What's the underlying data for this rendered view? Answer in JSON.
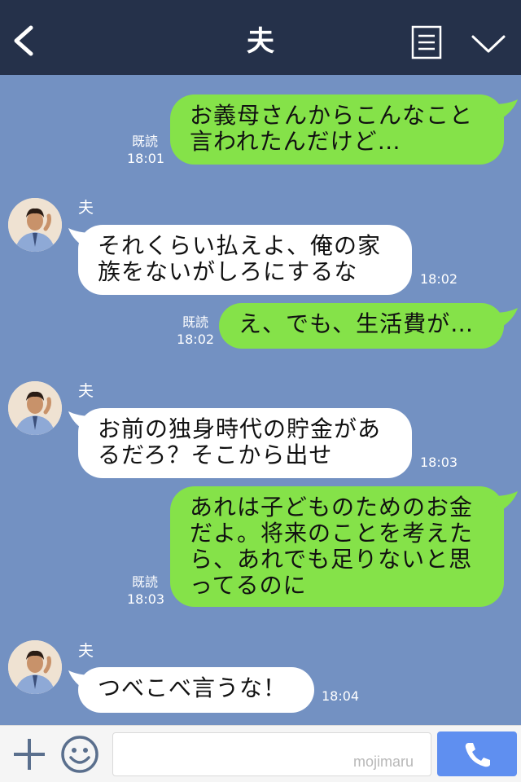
{
  "header": {
    "title": "夫",
    "back_icon": "chevron-left-icon",
    "menu_icon": "notes-icon",
    "collapse_icon": "chevron-down-icon"
  },
  "colors": {
    "header_bg": "#25314a",
    "chat_bg": "#7391c2",
    "outgoing_bubble": "#85e249",
    "incoming_bubble": "#ffffff",
    "call_button": "#5f8ff0"
  },
  "messages": [
    {
      "side": "out",
      "lines": [
        "お義母さんからこんなこと",
        "言われたんだけど…"
      ],
      "read": "既読",
      "time": "18:01"
    },
    {
      "side": "in",
      "sender": "夫",
      "lines": [
        "それくらい払えよ、俺の家",
        "族をないがしろにするな"
      ],
      "time": "18:02"
    },
    {
      "side": "out",
      "lines": [
        "え、でも、生活費が…"
      ],
      "read": "既読",
      "time": "18:02"
    },
    {
      "side": "in",
      "sender": "夫",
      "lines": [
        "お前の独身時代の貯金があ",
        "るだろ？そこから出せ"
      ],
      "time": "18:03"
    },
    {
      "side": "out",
      "lines": [
        "あれは子どものためのお金",
        "だよ。将来のことを考えた",
        "ら、あれでも足りないと思",
        "ってるのに"
      ],
      "read": "既読",
      "time": "18:03"
    },
    {
      "side": "in",
      "sender": "夫",
      "lines": [
        "つべこべ言うな！"
      ],
      "time": "18:04"
    }
  ],
  "bottom": {
    "plus_icon": "plus-icon",
    "emoji_icon": "smiley-icon",
    "watermark": "mojimaru",
    "call_icon": "phone-icon"
  }
}
